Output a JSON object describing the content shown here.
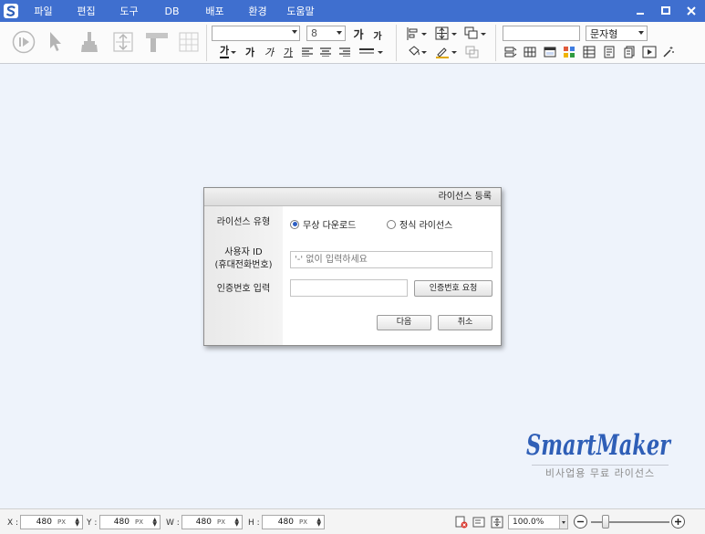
{
  "menu": {
    "items": [
      "파일",
      "편집",
      "도구",
      "DB",
      "배포",
      "환경",
      "도움말"
    ]
  },
  "window": {
    "minimize": "▬",
    "maximize": "▭",
    "close": "✕"
  },
  "toolbar": {
    "font_name": "",
    "font_size": "8",
    "bold_large": "가",
    "bold_small": "가",
    "font_color_glyph": "가",
    "fmt_bold": "가",
    "fmt_italic": "가",
    "fmt_underline": "가",
    "text_type": "문자형",
    "text_field": ""
  },
  "dialog": {
    "title": "라이선스 등록",
    "license_type_label": "라이선스 유형",
    "option_free": "무상 다운로드",
    "option_official": "정식 라이선스",
    "user_id_label_line1": "사용자 ID",
    "user_id_label_line2": "(휴대전화번호)",
    "user_id_placeholder": "'-' 없이 입력하세요",
    "auth_label": "인증번호 입력",
    "auth_request_button": "인증번호 요청",
    "next_button": "다음",
    "cancel_button": "취소"
  },
  "brand": {
    "name": "SmartMaker",
    "subtitle": "비사업용 무료 라이선스"
  },
  "statusbar": {
    "x_label": "X :",
    "x_value": "480",
    "x_unit": "PX",
    "y_label": "Y :",
    "y_value": "480",
    "y_unit": "PX",
    "w_label": "W :",
    "w_value": "480",
    "w_unit": "PX",
    "h_label": "H :",
    "h_value": "480",
    "h_unit": "PX",
    "zoom": "100.0%"
  },
  "colors": {
    "menubar": "#3f6fcf",
    "canvas": "#eef3fb",
    "brand_blue": "#2f5fb7"
  }
}
